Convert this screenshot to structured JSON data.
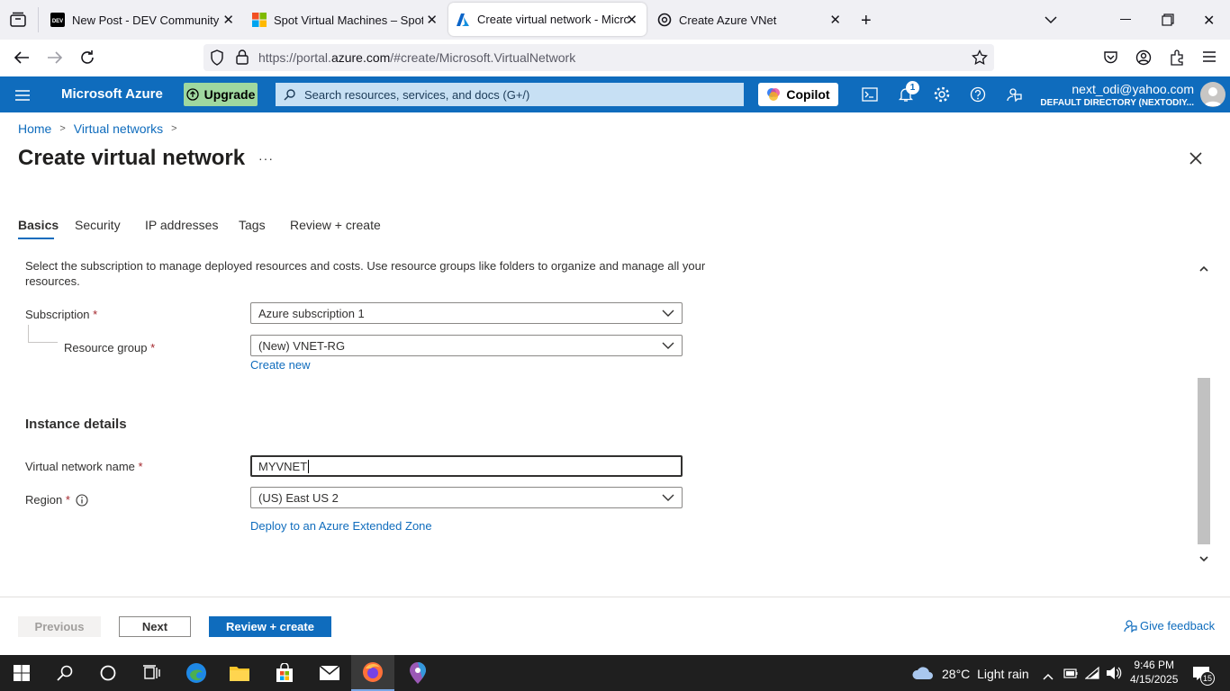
{
  "browser": {
    "tabs": [
      {
        "title": "New Post - DEV Community",
        "favicon": "dev-icon",
        "active": false
      },
      {
        "title": "Spot Virtual Machines – Spot Pr",
        "favicon": "microsoft-icon",
        "active": false
      },
      {
        "title": "Create virtual network - Micros",
        "favicon": "azure-icon",
        "active": true
      },
      {
        "title": "Create Azure VNet",
        "favicon": "chatgpt-icon",
        "active": false
      }
    ],
    "url_prefix": "https://portal.",
    "url_domain": "azure.com",
    "url_path": "/#create/Microsoft.VirtualNetwork"
  },
  "azure_header": {
    "brand": "Microsoft Azure",
    "upgrade_label": "Upgrade",
    "search_placeholder": "Search resources, services, and docs (G+/)",
    "copilot_label": "Copilot",
    "notification_count": "1",
    "account_email": "next_odi@yahoo.com",
    "account_directory": "DEFAULT DIRECTORY (NEXTODIY..."
  },
  "breadcrumb": {
    "home": "Home",
    "virtual_networks": "Virtual networks"
  },
  "page": {
    "title": "Create virtual network",
    "more": "···"
  },
  "wizard_tabs": [
    "Basics",
    "Security",
    "IP addresses",
    "Tags",
    "Review + create"
  ],
  "form": {
    "intro": "Select the subscription to manage deployed resources and costs. Use resource groups like folders to organize and manage all your resources.",
    "subscription_label": "Subscription",
    "subscription_value": "Azure subscription 1",
    "resource_group_label": "Resource group",
    "resource_group_value": "(New) VNET-RG",
    "create_new": "Create new",
    "instance_details": "Instance details",
    "vnet_name_label": "Virtual network name",
    "vnet_name_value": "MYVNET",
    "region_label": "Region",
    "region_value": "(US) East US 2",
    "extended_zone_link": "Deploy to an Azure Extended Zone",
    "required_mark": "*"
  },
  "footer": {
    "previous": "Previous",
    "next": "Next",
    "review_create": "Review + create",
    "feedback": "Give feedback"
  },
  "taskbar": {
    "weather_temp": "28°C",
    "weather_desc": "Light rain",
    "time": "9:46 PM",
    "date": "4/15/2025",
    "notification_count": "15"
  },
  "colors": {
    "azure_blue": "#0f6cbd",
    "upgrade_green": "#9fd89f",
    "required_red": "#a4262c"
  }
}
